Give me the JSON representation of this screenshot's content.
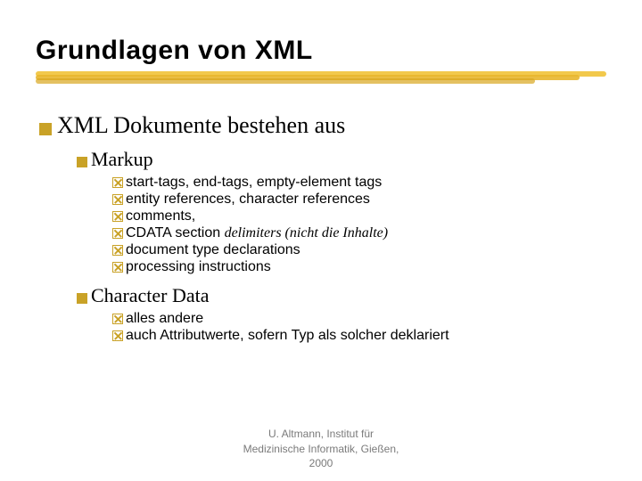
{
  "title": "Grundlagen von XML",
  "lvl1": "XML Dokumente bestehen aus",
  "markup": {
    "heading": "Markup",
    "items": [
      {
        "text": "start-tags, end-tags, empty-element tags"
      },
      {
        "text": "entity references, character references"
      },
      {
        "text": "comments,"
      },
      {
        "prefix": "CDATA section ",
        "italic": "delimiters (nicht die Inhalte)"
      },
      {
        "text": "document type declarations"
      },
      {
        "text": "processing instructions"
      }
    ]
  },
  "chardata": {
    "heading": "Character Data",
    "items": [
      {
        "text": "alles andere"
      },
      {
        "text": "auch Attributwerte, sofern Typ als solcher deklariert"
      }
    ]
  },
  "footer": {
    "line1": "U. Altmann, Institut für",
    "line2": "Medizinische Informatik, Gießen,",
    "line3": "2000"
  }
}
